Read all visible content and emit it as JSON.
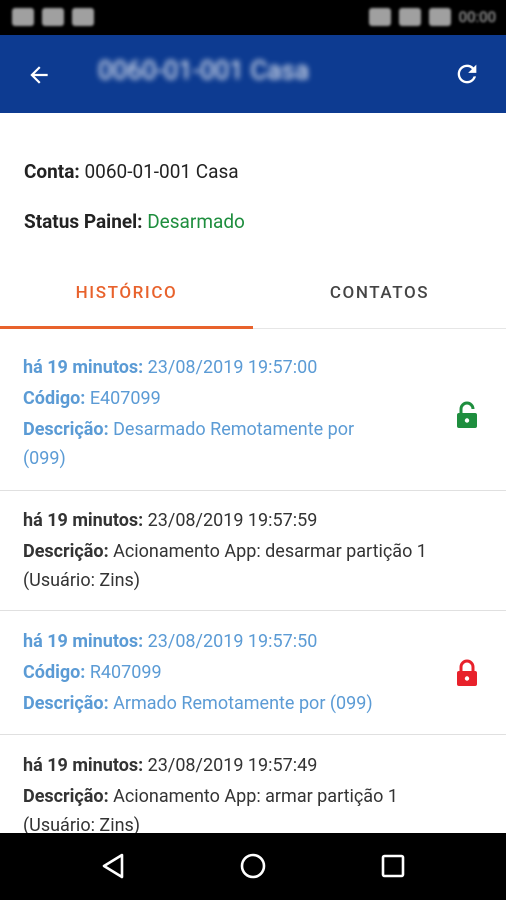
{
  "app_bar": {
    "title": "0060-01-001 Casa"
  },
  "info": {
    "conta_label": "Conta:",
    "conta_value": "0060-01-001 Casa",
    "status_label": "Status Painel:",
    "status_value": "Desarmado"
  },
  "tabs": [
    {
      "label": "HISTÓRICO",
      "active": true
    },
    {
      "label": "CONTATOS",
      "active": false
    }
  ],
  "events": [
    {
      "time_label": "há 19 minutos:",
      "time_value": "23/08/2019 19:57:00",
      "code_label": "Código:",
      "code_value": "E407099",
      "desc_label": "Descrição:",
      "desc_value": "Desarmado Remotamente por",
      "desc_value_2": "(099)",
      "icon": "unlocked",
      "icon_color": "#1e8e3e"
    },
    {
      "time_label": "há 19 minutos:",
      "time_value": "23/08/2019 19:57:59",
      "desc_label": "Descrição:",
      "desc_value": "Acionamento App: desarmar partição 1",
      "desc_value_2": "(Usuário: Zins)"
    },
    {
      "time_label": "há 19 minutos:",
      "time_value": "23/08/2019 19:57:50",
      "code_label": "Código:",
      "code_value": "R407099",
      "desc_label": "Descrição:",
      "desc_value": "Armado Remotamente por (099)",
      "icon": "locked",
      "icon_color": "#e8212b"
    },
    {
      "time_label": "há 19 minutos:",
      "time_value": "23/08/2019 19:57:49",
      "desc_label": "Descrição:",
      "desc_value": "Acionamento App: armar partição 1",
      "desc_value_2": "(Usuário: Zins)"
    }
  ],
  "colors": {
    "app_bar": "#0d3b91",
    "accent": "#e8622c",
    "link_blue": "#5b9bd5",
    "status_ok": "#1e8e3e"
  }
}
